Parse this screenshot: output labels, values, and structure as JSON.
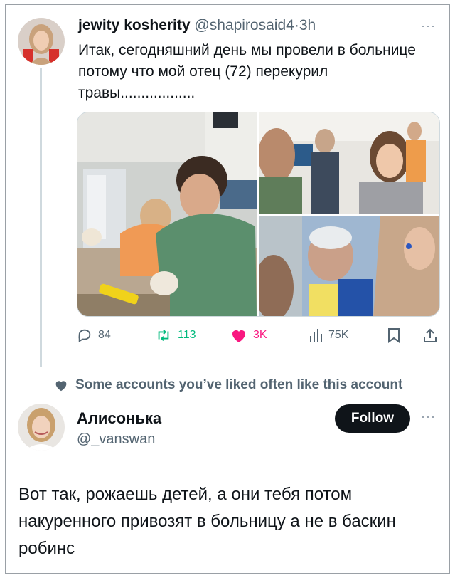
{
  "tweet1": {
    "display_name": "jewity kosherity",
    "handle": "@shapirosaid4",
    "separator": "·",
    "time": "3h",
    "more_label": "···",
    "text": "Итак, сегодняшний день мы провели в больнице потому что мой отец (72) перекурил травы..................",
    "media_count": 3,
    "actions": {
      "replies": "84",
      "reposts": "113",
      "likes": "3K",
      "views": "75K"
    }
  },
  "liked_note": "Some accounts you’ve liked often like this account",
  "tweet2": {
    "display_name": "Алисонька",
    "handle": "@_vanswan",
    "follow_label": "Follow",
    "more_label": "···",
    "text": "Вот так, рожаешь детей, а они тебя потом накуренного привозят в больницу а не в баскин робинс"
  },
  "colors": {
    "text": "#0f1419",
    "muted": "#536471",
    "repost_green": "#00ba7c",
    "like_pink": "#f91880",
    "follow_bg": "#0f1419"
  },
  "icons": [
    "reply-icon",
    "repost-icon",
    "like-icon",
    "views-icon",
    "bookmark-icon",
    "share-icon",
    "heart-small-icon"
  ]
}
